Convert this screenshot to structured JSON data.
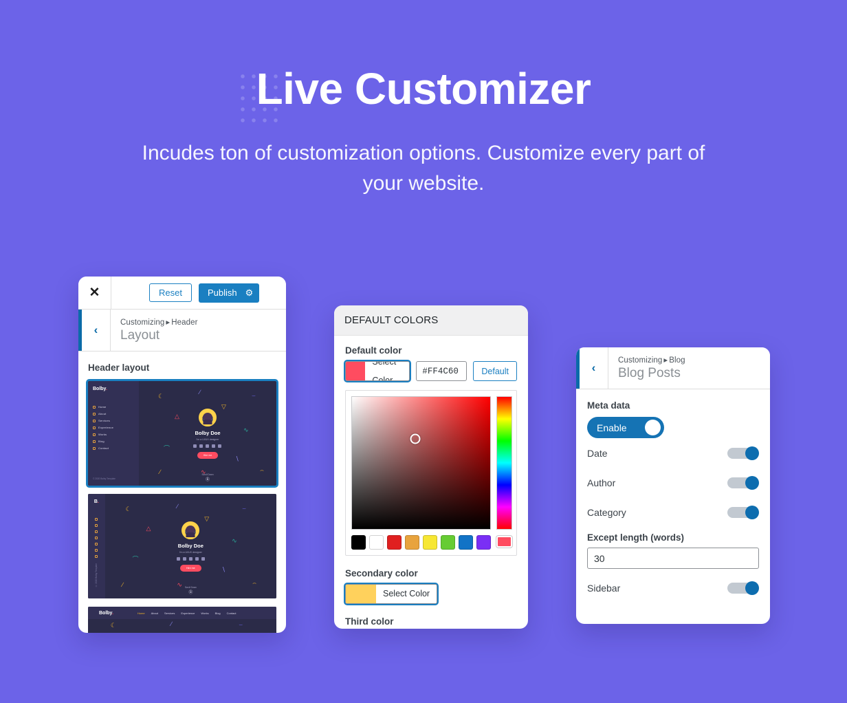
{
  "hero": {
    "title": "Live Customizer",
    "subtitle": "Incudes ton of customization options. Customize every part of your website.",
    "background_color": "#6c63e8"
  },
  "panel_header": {
    "close_label": "✕",
    "reset_label": "Reset",
    "publish_label": "Publish",
    "gear_icon": "⚙",
    "back_icon": "‹",
    "breadcrumb_prefix": "Customizing",
    "breadcrumb_separator": "▸",
    "breadcrumb_section": "Header",
    "title": "Layout",
    "section_label": "Header layout",
    "accent_color": "#0b6ba8",
    "publish_color": "#1a7fc1",
    "previews": [
      {
        "name": "sidebar-wide",
        "selected": true
      },
      {
        "name": "sidebar-icons",
        "selected": false
      },
      {
        "name": "top-nav",
        "selected": false
      }
    ],
    "preview_site": {
      "logo": "Bolby",
      "logo_dot": ".",
      "nav": [
        "Home",
        "About",
        "Services",
        "Experience",
        "Works",
        "Blog",
        "Contact"
      ],
      "name": "Bolby Doe",
      "tagline": "I'm a UI/UX designer",
      "cta_label": "Hire me",
      "scroll_label": "Scroll Down",
      "scroll_icon": "Ⓑ",
      "copyright": "© 2020 Bolby Template"
    }
  },
  "panel_colors": {
    "header": "DEFAULT COLORS",
    "default_color": {
      "label": "Default color",
      "select_label": "Select Color",
      "hex": "#FF4C60",
      "default_label": "Default",
      "swatch": "#FF4C60"
    },
    "picker": {
      "presets": [
        "#000000",
        "#ffffff",
        "#e02020",
        "#e8a33d",
        "#f7e733",
        "#66cc33",
        "#1273c6",
        "#7a2ff5"
      ],
      "hue_handle_color": "#ff4c60"
    },
    "secondary_color": {
      "label": "Secondary color",
      "select_label": "Select Color",
      "swatch": "#FFD15C"
    },
    "third_color": {
      "label": "Third color",
      "swatch": "#6c6ce5"
    }
  },
  "panel_blog": {
    "back_icon": "‹",
    "breadcrumb_prefix": "Customizing",
    "breadcrumb_separator": "▸",
    "breadcrumb_section": "Blog",
    "title": "Blog Posts",
    "meta_label": "Meta data",
    "enable_label": "Enable",
    "toggles": [
      {
        "label": "Date",
        "on": true
      },
      {
        "label": "Author",
        "on": true
      },
      {
        "label": "Category",
        "on": true
      }
    ],
    "excerpt_label": "Except length (words)",
    "excerpt_value": "30",
    "sidebar_toggle": {
      "label": "Sidebar",
      "on": true
    }
  }
}
